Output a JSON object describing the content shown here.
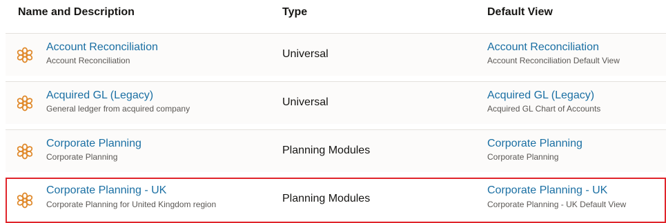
{
  "columns": {
    "name": "Name and Description",
    "type": "Type",
    "view": "Default View"
  },
  "colors": {
    "link": "#1a6fa3",
    "icon": "#e08a2c",
    "highlight_border": "#e0242a"
  },
  "rows": [
    {
      "icon": "application-flower-icon",
      "name": "Account Reconciliation",
      "description": "Account Reconciliation",
      "type": "Universal",
      "view_name": "Account Reconciliation",
      "view_description": "Account Reconciliation Default View"
    },
    {
      "icon": "application-flower-icon",
      "name": "Acquired GL (Legacy)",
      "description": "General ledger from acquired company",
      "type": "Universal",
      "view_name": "Acquired GL (Legacy)",
      "view_description": "Acquired GL Chart of Accounts"
    },
    {
      "icon": "application-flower-icon",
      "name": "Corporate Planning",
      "description": "Corporate Planning",
      "type": "Planning Modules",
      "view_name": "Corporate Planning",
      "view_description": "Corporate Planning"
    },
    {
      "icon": "application-flower-icon",
      "name": "Corporate Planning - UK",
      "description": "Corporate Planning for United Kingdom region",
      "type": "Planning Modules",
      "view_name": "Corporate Planning - UK",
      "view_description": "Corporate Planning - UK Default View",
      "highlighted": true
    }
  ]
}
